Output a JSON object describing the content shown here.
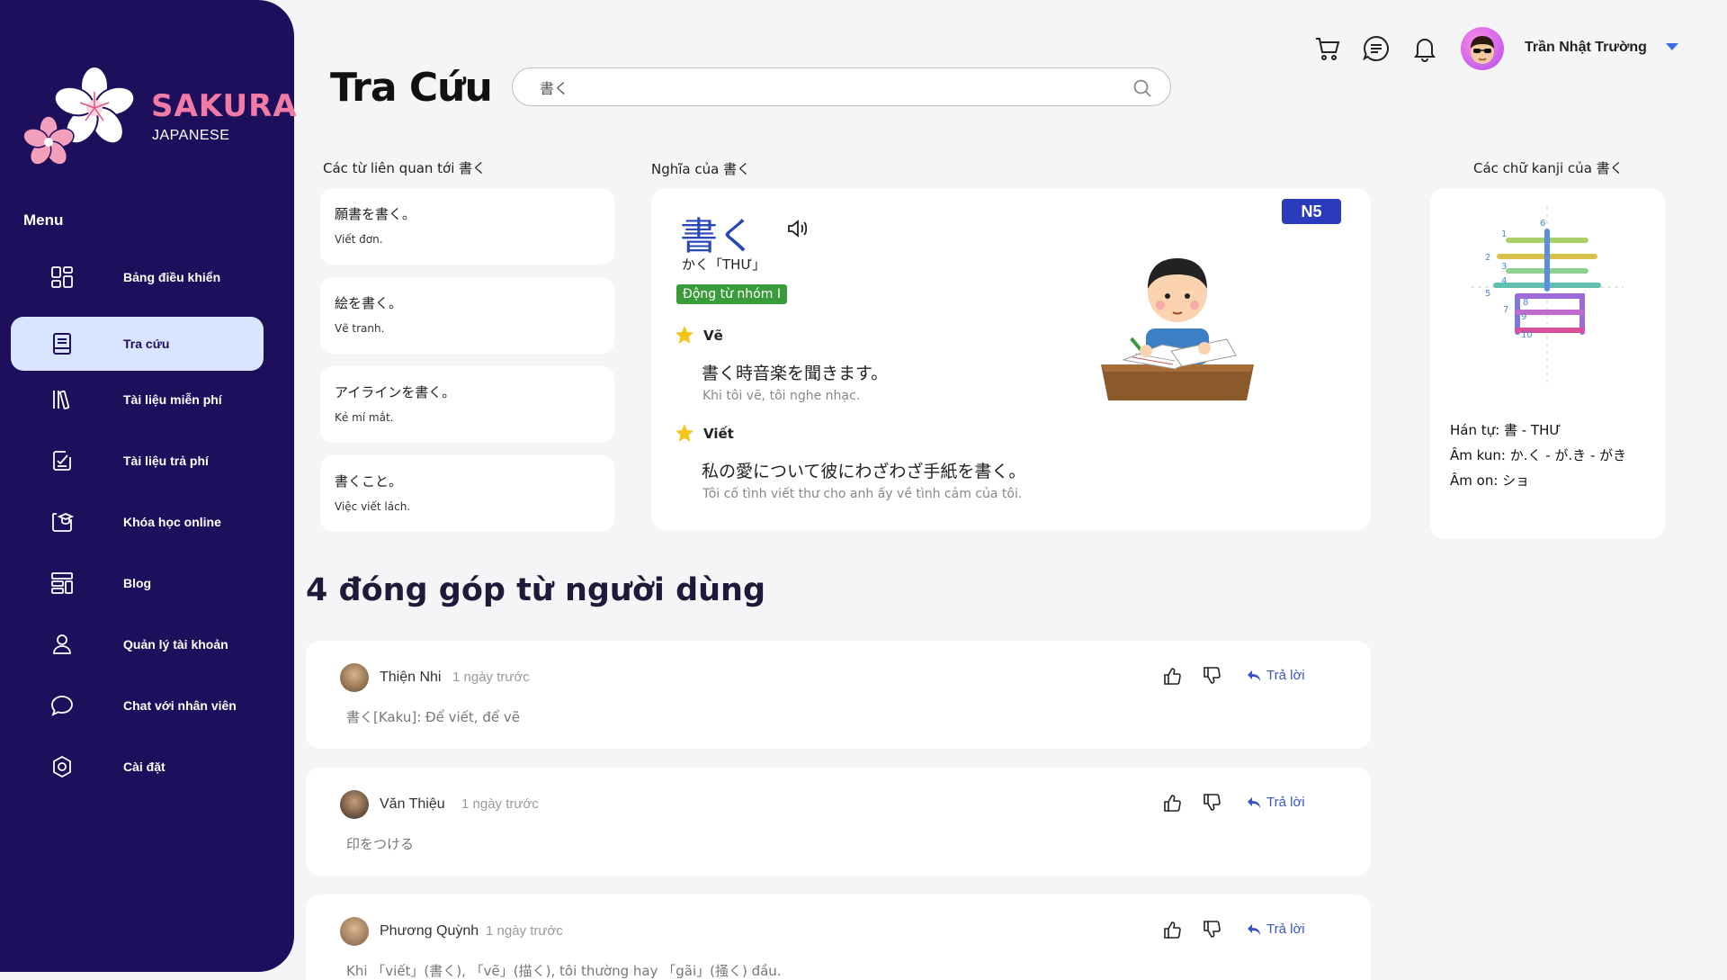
{
  "brand": {
    "name": "SAKURA",
    "subtitle": "JAPANESE"
  },
  "sidebar": {
    "menu_title": "Menu",
    "items": [
      {
        "label": "Bảng điều khiển",
        "icon": "dashboard-icon"
      },
      {
        "label": "Tra cứu",
        "icon": "book-icon",
        "active": true
      },
      {
        "label": "Tài liệu miễn phí",
        "icon": "library-icon"
      },
      {
        "label": "Tài liệu trả phí",
        "icon": "paid-doc-icon"
      },
      {
        "label": "Khóa học online",
        "icon": "graduation-icon"
      },
      {
        "label": "Blog",
        "icon": "blog-icon"
      },
      {
        "label": "Quản lý tài khoản",
        "icon": "user-icon"
      },
      {
        "label": "Chat với nhân viên",
        "icon": "chat-icon"
      },
      {
        "label": "Cài đặt",
        "icon": "settings-icon"
      }
    ]
  },
  "header": {
    "title": "Tra Cứu",
    "search_value": "書く",
    "user_name": "Trần Nhật Trường"
  },
  "related": {
    "title": "Các từ liên quan tới 書く",
    "items": [
      {
        "jp": "願書を書く。",
        "vi": "Viết đơn."
      },
      {
        "jp": "絵を書く。",
        "vi": "Vẽ tranh."
      },
      {
        "jp": "アイラインを書く。",
        "vi": "Kẻ mí mắt."
      },
      {
        "jp": "書くこと。",
        "vi": "Việc viết lách."
      }
    ]
  },
  "meaning": {
    "title": "Nghĩa của 書く",
    "word": "書く",
    "reading": "かく「THƯ」",
    "type": "Động từ nhóm I",
    "level": "N5",
    "senses": [
      {
        "title": "Vẽ",
        "example_jp": "書く時音楽を聞きます。",
        "example_vi": "Khi tôi vẽ, tôi nghe nhạc."
      },
      {
        "title": "Viết",
        "example_jp": "私の愛について彼にわざわざ手紙を書く。",
        "example_vi": "Tôi cố tình viết thư cho anh ấy về tình cảm của tôi."
      }
    ]
  },
  "kanji": {
    "title": "Các chữ kanji của 書く",
    "han_tu": "Hán tự: 書 - THƯ",
    "am_kun": "Âm kun: か.く - が.き - がき",
    "am_on": "Âm on: ショ",
    "stroke_numbers": [
      "1",
      "2",
      "3",
      "4",
      "5",
      "6",
      "7",
      "8",
      "9",
      "10"
    ]
  },
  "contributions": {
    "heading": "4 đóng góp từ người dùng",
    "reply_label": "Trả lời",
    "items": [
      {
        "name": "Thiện Nhi",
        "time": "1 ngày trước",
        "text": "書く[Kaku]: Để viết, để vẽ"
      },
      {
        "name": "Văn Thiệu",
        "time": "1 ngày trước",
        "text": "印をつける"
      },
      {
        "name": "Phương Quỳnh",
        "time": "1 ngày trước",
        "text": "Khi 「viết」(書く), 「vẽ」(描く), tôi thường hay 「gãi」(掻く) đầu."
      }
    ]
  },
  "colors": {
    "sidebar_bg": "#1e0f5c",
    "brand_pink": "#f27aa6",
    "active_nav_bg": "#d9e4ff",
    "kanji_blue": "#2b48b8",
    "type_green": "#3a9b3a",
    "level_blue": "#2b3bbd",
    "reply_blue": "#3b55c7"
  }
}
